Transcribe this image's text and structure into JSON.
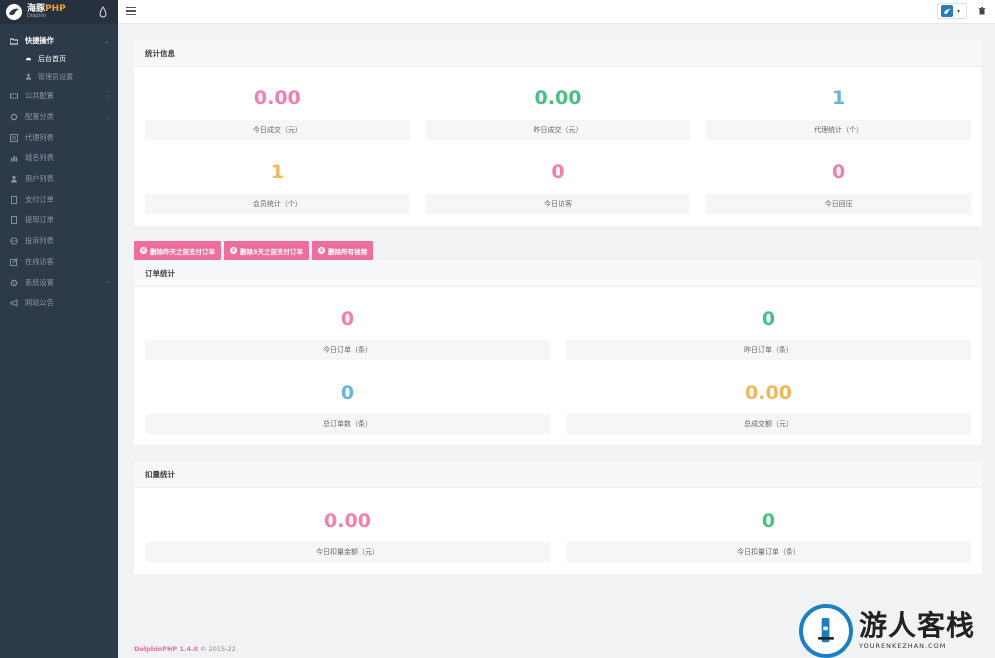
{
  "app": {
    "brand_main": "海豚",
    "brand_php": "PHP",
    "brand_sub": "Dolphin"
  },
  "sidebar": {
    "open_section": "快捷操作",
    "sub_items": [
      "后台首页",
      "管理员设置"
    ],
    "items": [
      "公共配置",
      "配置分类",
      "代理列表",
      "城名列表",
      "用户列表",
      "支付订单",
      "提现订单",
      "投诉列表",
      "在线访客",
      "系统设置",
      "网站公告"
    ]
  },
  "stats_panel": {
    "title": "统计信息",
    "cards": [
      {
        "value": "0.00",
        "label": "今日成交（元）",
        "color": "#f37fb0"
      },
      {
        "value": "0.00",
        "label": "昨日成交（元）",
        "color": "#4cbf84"
      },
      {
        "value": "1",
        "label": "代理统计（个）",
        "color": "#66b6dc"
      },
      {
        "value": "1",
        "label": "会员统计（个）",
        "color": "#f0b85a"
      },
      {
        "value": "0",
        "label": "今日访客",
        "color": "#f37fb0"
      },
      {
        "value": "0",
        "label": "今日回压",
        "color": "#f37fb0"
      }
    ]
  },
  "actions": {
    "buttons": [
      "删除昨天之前支付订单",
      "删除3天之前支付订单",
      "删除所有视频"
    ]
  },
  "orders_panel": {
    "title": "订单统计",
    "cards": [
      {
        "value": "0",
        "label": "今日订单（条）",
        "color": "#f37fb0"
      },
      {
        "value": "0",
        "label": "昨日订单（条）",
        "color": "#4cbf84"
      },
      {
        "value": "0",
        "label": "总订单数（条）",
        "color": "#66b6dc"
      },
      {
        "value": "0.00",
        "label": "总成交额（元）",
        "color": "#f0b85a"
      }
    ]
  },
  "deduct_panel": {
    "title": "扣量统计",
    "cards": [
      {
        "value": "0.00",
        "label": "今日扣量金额（元）",
        "color": "#f37fb0"
      },
      {
        "value": "0",
        "label": "今日扣量订单（条）",
        "color": "#4cbf84"
      }
    ]
  },
  "footer": {
    "brand": "DolphinPHP 1.4.0",
    "copyright": "© 2015-22"
  },
  "watermark": {
    "title": "游人客栈",
    "sub": "YOURENKEZHAN.COM"
  }
}
